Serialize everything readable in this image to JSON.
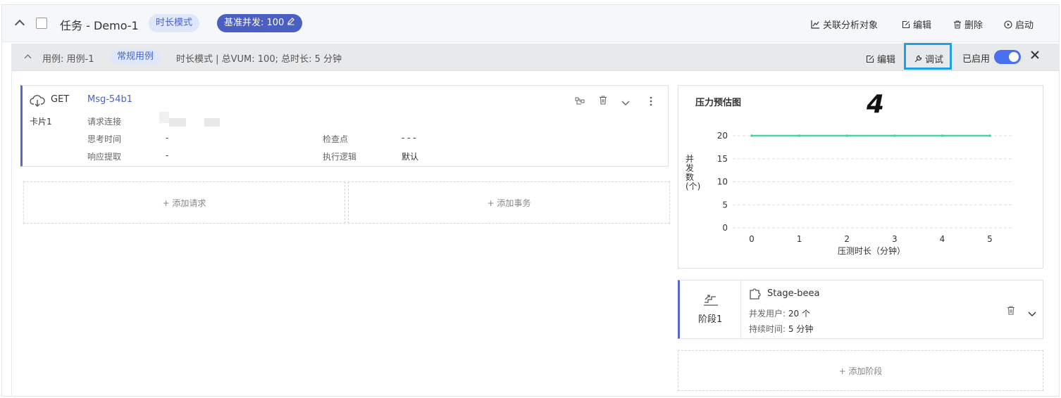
{
  "task": {
    "title": "任务 - Demo-1",
    "mode_tag": "时长模式",
    "baseline_tag": "基准并发: 100",
    "actions": {
      "link_analysis": "关联分析对象",
      "edit": "编辑",
      "delete": "删除",
      "start": "启动"
    }
  },
  "case": {
    "name": "用例: 用例-1",
    "type_tag": "常规用例",
    "summary": "时长模式 | 总VUM: 100;  总时长: 5 分钟",
    "actions": {
      "edit": "编辑",
      "debug": "调试",
      "enabled_label": "已启用",
      "enabled": true
    }
  },
  "step_marker": "4",
  "request_card": {
    "method": "GET",
    "name": "Msg-54b1",
    "card_label": "卡片1",
    "fields": {
      "request_url_label": "请求连接",
      "think_time_label": "思考时间",
      "think_time_value": "-",
      "checkpoint_label": "检查点",
      "checkpoint_value": "- - -",
      "response_extract_label": "响应提取",
      "response_extract_value": "-",
      "exec_logic_label": "执行逻辑",
      "exec_logic_value": "默认"
    }
  },
  "add_request": "+ 添加请求",
  "add_transaction": "+ 添加事务",
  "chart_data": {
    "type": "line",
    "title": "压力预估图",
    "xlabel": "压测时长（分钟）",
    "ylabel": "并发数(个)",
    "x": [
      0,
      1,
      2,
      3,
      4,
      5
    ],
    "series": [
      {
        "values": [
          20,
          20,
          20,
          20,
          20,
          20
        ]
      }
    ],
    "ylim": [
      0,
      20
    ],
    "yticks": [
      0,
      5,
      10,
      15,
      20
    ],
    "xticks": [
      0,
      1,
      2,
      3,
      4,
      5
    ],
    "grid": true,
    "color": "#4cd4a0"
  },
  "stage": {
    "label": "阶段1",
    "name": "Stage-beea",
    "users_label": "并发用户:",
    "users_value": "20 个",
    "duration_label": "持续时间:",
    "duration_value": "5 分钟"
  },
  "add_stage": "+ 添加阶段"
}
